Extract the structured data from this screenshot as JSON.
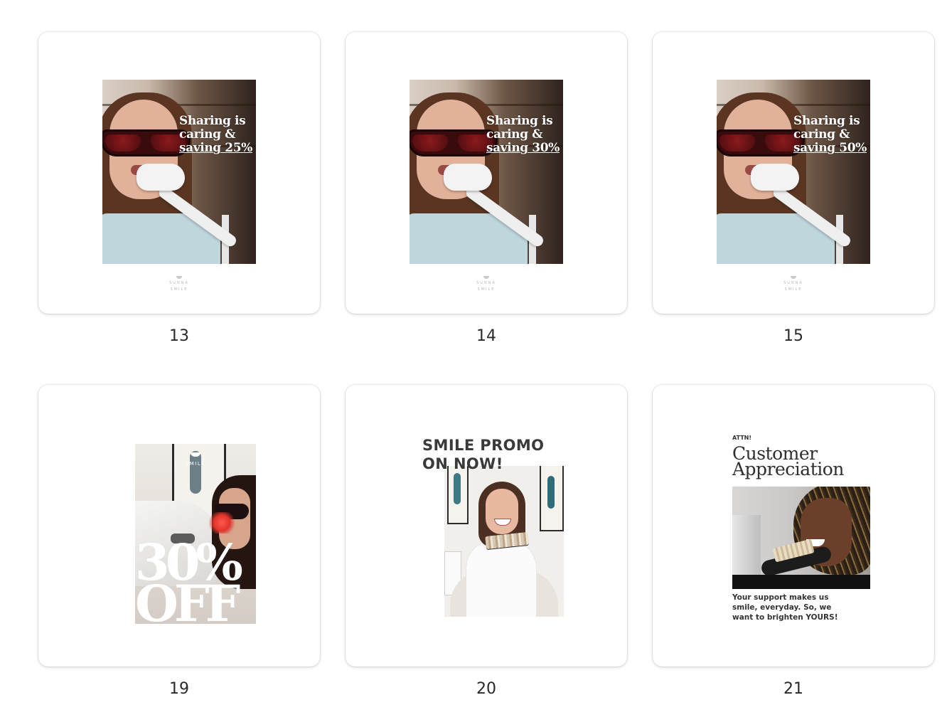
{
  "cards": [
    {
      "number": "13",
      "lines": [
        "Sharing is",
        "caring &",
        "saving 25%"
      ],
      "logo": {
        "top": "SUNNA",
        "bottom": "SMILE"
      }
    },
    {
      "number": "14",
      "lines": [
        "Sharing is",
        "caring &",
        "saving 30%"
      ],
      "logo": {
        "top": "SUNNA",
        "bottom": "SMILE"
      }
    },
    {
      "number": "15",
      "lines": [
        "Sharing is",
        "caring &",
        "saving 50%"
      ],
      "logo": {
        "top": "SUNNA",
        "bottom": "SMILE"
      }
    },
    {
      "number": "19",
      "brand": "SMILE",
      "big_lines": [
        "30%",
        "OFF"
      ]
    },
    {
      "number": "20",
      "title_lines": [
        "SMILE PROMO",
        "ON NOW!"
      ]
    },
    {
      "number": "21",
      "attn": "ATTN!",
      "title_lines": [
        "Customer",
        "Appreciation"
      ],
      "body_lines": [
        "Your support makes us",
        "smile, everyday. So, we",
        "want to brighten YOURS!"
      ]
    }
  ],
  "colors": {
    "page_background": "#ffffff",
    "card_background": "#ffffff",
    "number_text": "#2a2a2a"
  }
}
